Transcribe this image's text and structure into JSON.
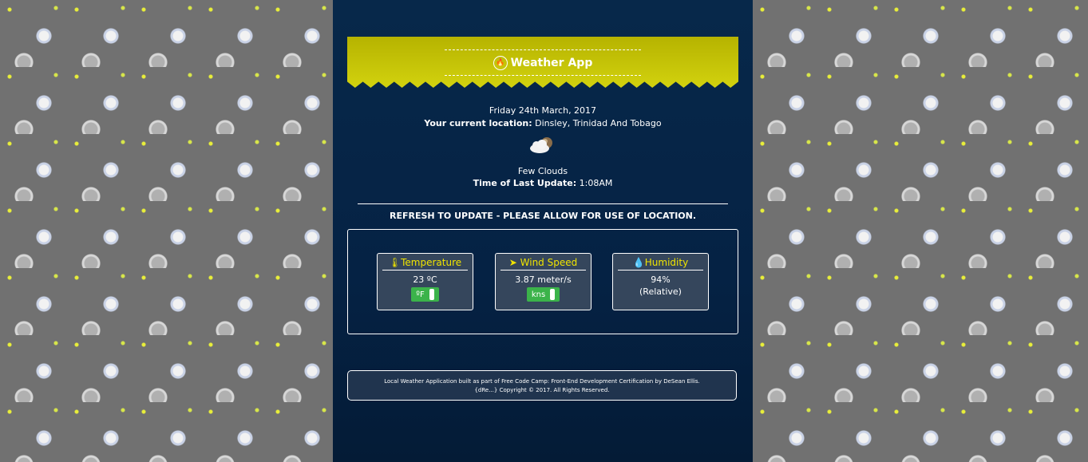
{
  "header": {
    "title": "Weather App",
    "fire_icon": "fire-icon"
  },
  "info": {
    "date": "Friday 24th March, 2017",
    "location_label": "Your current location:",
    "location_value": "Dinsley, Trinidad And Tobago",
    "condition": "Few Clouds",
    "update_label": "Time of Last Update:",
    "update_value": "1:08AM"
  },
  "refresh_text": "REFRESH TO UPDATE - PLEASE ALLOW FOR USE OF LOCATION.",
  "cards": {
    "temperature": {
      "title": "Temperature",
      "value": "23 ºC",
      "toggle": "ºF"
    },
    "wind": {
      "title": "Wind Speed",
      "value": "3.87 meter/s",
      "toggle": "kns"
    },
    "humidity": {
      "title": "Humidity",
      "value": "94%",
      "note": "(Relative)"
    }
  },
  "footer": {
    "line1": "Local Weather Application built as part of Free Code Camp: Front-End Development Certification by DeSean Ellis.",
    "line2": "{dRe...} Copyright © 2017. All Rights Reserved."
  },
  "colors": {
    "banner": "#c9c800",
    "accent": "#f0e400",
    "toggle": "#3bb34a",
    "panel": "#06264a"
  }
}
